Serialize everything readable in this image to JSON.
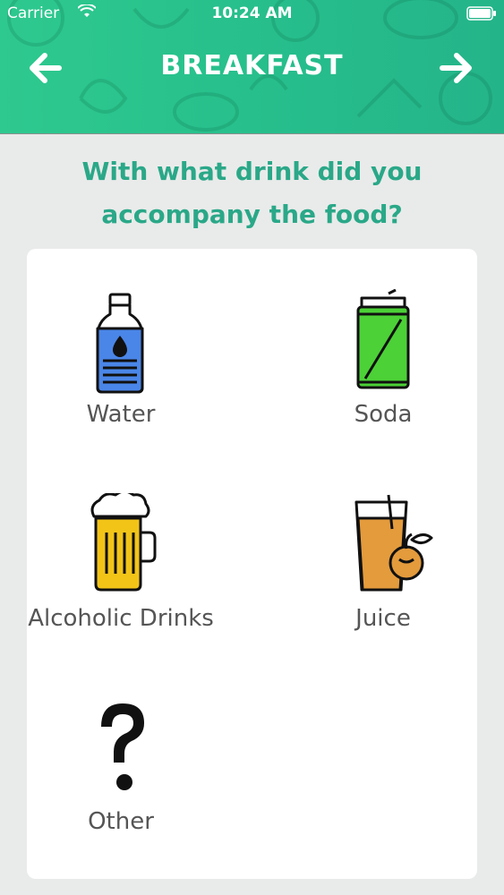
{
  "status_bar": {
    "carrier": "Carrier",
    "time": "10:24 AM"
  },
  "header": {
    "title": "BREAKFAST",
    "back_icon": "arrow-left-icon",
    "forward_icon": "arrow-right-icon"
  },
  "question": {
    "line1": "With what drink did you",
    "line2": "accompany the food?"
  },
  "options": [
    {
      "label": "Water",
      "icon": "water-bottle-icon"
    },
    {
      "label": "Soda",
      "icon": "soda-can-icon"
    },
    {
      "label": "Alcoholic Drinks",
      "icon": "beer-mug-icon"
    },
    {
      "label": "Juice",
      "icon": "juice-glass-icon"
    },
    {
      "label": "Other",
      "icon": "question-mark-icon"
    }
  ],
  "colors": {
    "header": "#27bf8c",
    "accent": "#2aa888",
    "background": "#e9ebea"
  }
}
